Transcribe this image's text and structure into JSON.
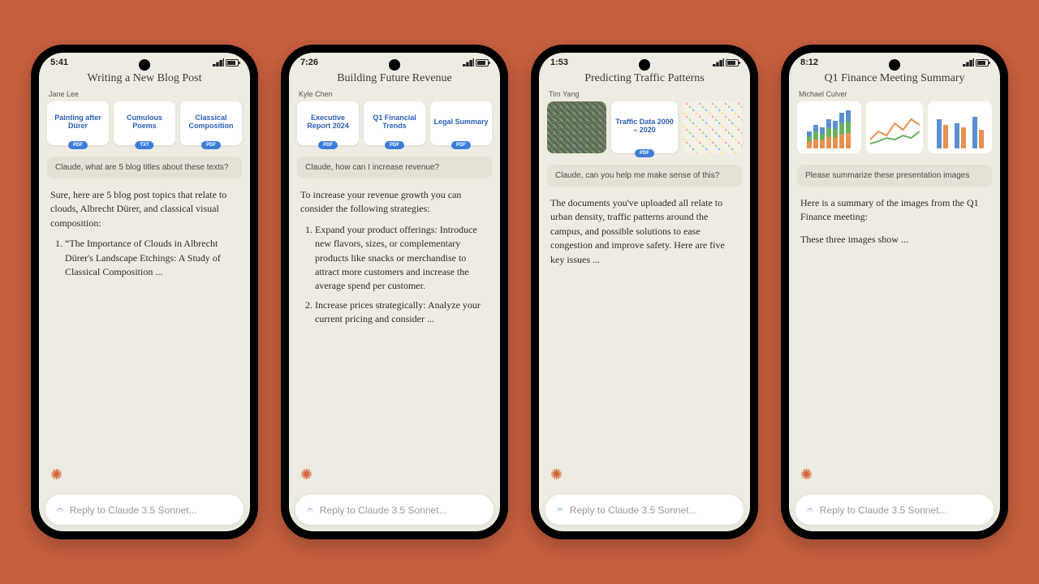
{
  "phones": [
    {
      "time": "5:41",
      "title": "Writing a New Blog Post",
      "author": "Jane Lee",
      "attachments": [
        {
          "title": "Painting after Dürer",
          "badge": "PDF"
        },
        {
          "title": "Cumulous Poems",
          "badge": "TXT"
        },
        {
          "title": "Classical Composition",
          "badge": "PDF"
        }
      ],
      "prompt": "Claude, what are 5 blog titles about these texts?",
      "response_intro": "Sure, here are 5 blog post topics that relate to clouds, Albrecht Dürer, and classical visual composition:",
      "response_items": [
        "“The Importance of Clouds in Albrecht Dürer's Landscape Etchings: A Study of Classical Composition ..."
      ],
      "reply_placeholder": "Reply to Claude 3.5 Sonnet..."
    },
    {
      "time": "7:26",
      "title": "Building Future Revenue",
      "author": "Kyle Chen",
      "attachments": [
        {
          "title": "Executive Report 2024",
          "badge": "PDF"
        },
        {
          "title": "Q1 Financial Trends",
          "badge": "PDF"
        },
        {
          "title": "Legal Summary",
          "badge": "PDF"
        }
      ],
      "prompt": "Claude, how can I increase revenue?",
      "response_intro": "To increase your revenue growth you can consider the following strategies:",
      "response_items": [
        "Expand your product offerings: Introduce new flavors, sizes, or complementary products like snacks or merchandise to attract more customers and increase the average spend per customer.",
        "Increase prices strategically: Analyze your current pricing and consider ..."
      ],
      "reply_placeholder": "Reply to Claude 3.5 Sonnet..."
    },
    {
      "time": "1:53",
      "title": "Predicting Traffic Patterns",
      "author": "Tim Yang",
      "attachments_img": [
        {
          "kind": "aerial"
        },
        {
          "kind": "doc",
          "title": "Traffic Data 2000 – 2020",
          "badge": "PDF"
        },
        {
          "kind": "sticky"
        }
      ],
      "prompt": "Claude, can you help me make sense of this?",
      "response_intro": "The documents you've uploaded all relate to urban density, traffic patterns around the campus, and possible solutions to ease congestion and improve safety. Here are five key issues ...",
      "reply_placeholder": "Reply to Claude 3.5 Sonnet..."
    },
    {
      "time": "8:12",
      "title": "Q1 Finance Meeting Summary",
      "author": "Michael Culver",
      "attachments_charts": [
        "bars",
        "lines",
        "grouped"
      ],
      "prompt": "Please summarize these presentation images",
      "response_intro": "Here is a summary of the images from the Q1 Finance meeting:",
      "response_extra": "These three images show ...",
      "reply_placeholder": "Reply to Claude 3.5 Sonnet..."
    }
  ]
}
